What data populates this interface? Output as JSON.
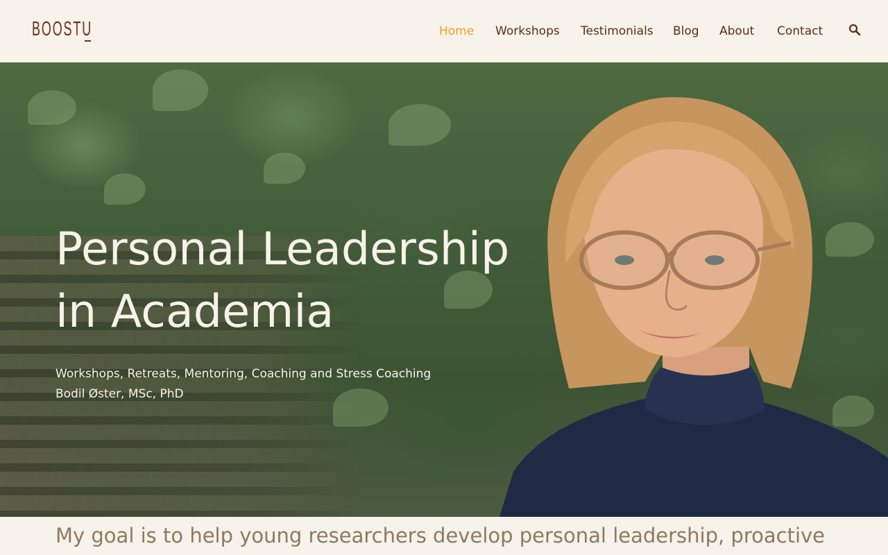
{
  "header": {
    "logo_text": "BOOSTU",
    "nav": [
      {
        "label": "Home",
        "active": true
      },
      {
        "label": "Workshops"
      },
      {
        "label": "Testimonials"
      },
      {
        "label": "Blog"
      },
      {
        "label": "About"
      },
      {
        "label": "Contact"
      }
    ],
    "search_icon": "search-icon"
  },
  "hero": {
    "title_line1": "Personal Leadership",
    "title_line2": "in Academia",
    "subtitle_line1": "Workshops, Retreats, Mentoring, Coaching and Stress Coaching",
    "subtitle_line2": "Bodil Øster, MSc, PhD"
  },
  "intro": {
    "goal_text": "My goal is to help young researchers develop personal leadership, proactive"
  },
  "colors": {
    "background": "#f7f2ea",
    "brand": "#6b2f1f",
    "nav_text": "#5a2e1c",
    "nav_active": "#e9a227",
    "hero_text": "#f7f2ea",
    "intro_text": "#8c7a62"
  }
}
